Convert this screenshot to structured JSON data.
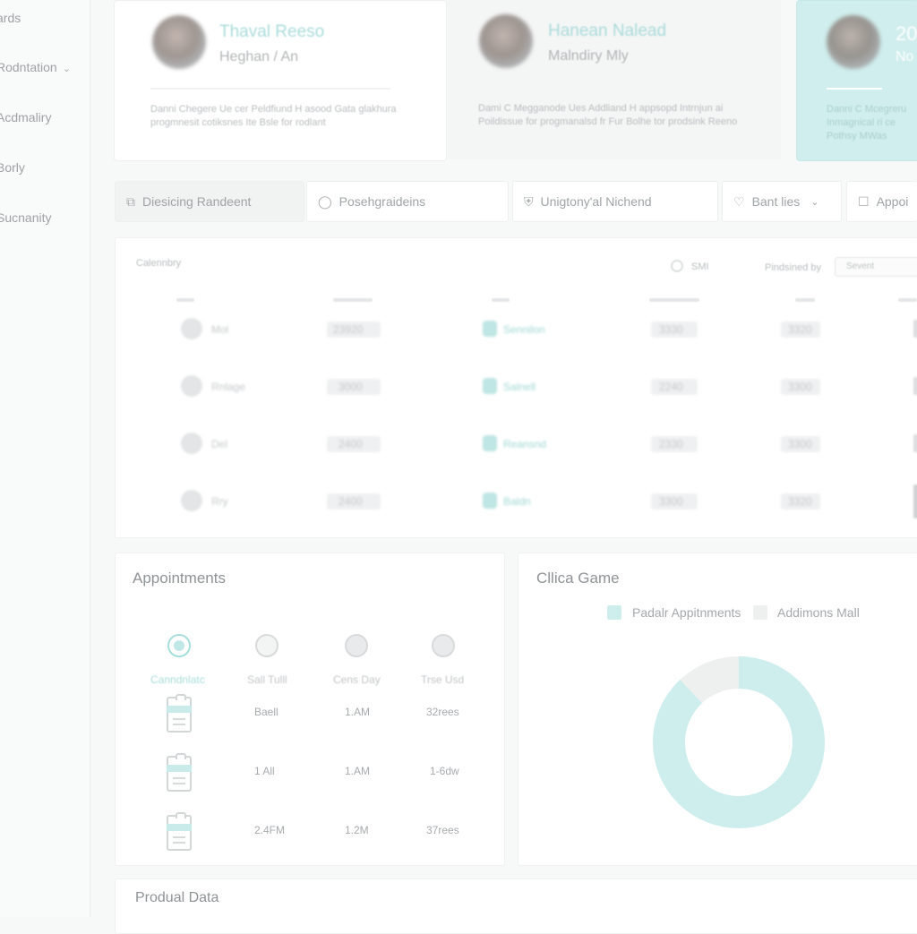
{
  "sidebar": {
    "items": [
      {
        "label": "ards"
      },
      {
        "label": "Rodntation"
      },
      {
        "label": "Acdmaliry"
      },
      {
        "label": "Borly"
      },
      {
        "label": "Sucnanity"
      }
    ]
  },
  "profiles": [
    {
      "name": "Thaval Reeso",
      "role": "Heghan / An",
      "desc": "Danni Chegere Ue cer Peldfiund H asood Gata glakhura progmnesit cotiksnes Ite Bsle for rodlant"
    },
    {
      "name": "Hanean Nalead",
      "role": "Malndiry Mly",
      "desc": "Dami C Megganode Ues Addliand H appsopd Intrnjun ai Poildissue for progmanalsd fr Fur Bolhe tor prodsink Reeno"
    },
    {
      "name": "20",
      "role": "No",
      "desc": "Danni C Mcegreru Inmagnical ri ce Pothsy MWas"
    }
  ],
  "tabs": [
    {
      "label": "Diesicing Randeent",
      "icon": "add-square-icon"
    },
    {
      "label": "Posehgraideins",
      "icon": "chat-bubble-icon"
    },
    {
      "label": "Unigtony'al Nichend",
      "icon": "shield-icon"
    },
    {
      "label": "Bant lies",
      "icon": "heart-icon"
    },
    {
      "label": "Appoi",
      "icon": "checkbox-icon"
    }
  ],
  "table": {
    "header_left": "Calennbry",
    "header_mid": "SMI",
    "header_right_label": "Pindsined by",
    "select_value": "Sevent",
    "rows": [
      {
        "c1": "Mol",
        "c2": "23920",
        "c3": "Sennilon",
        "c4": "3330",
        "c5": "3320"
      },
      {
        "c1": "Rnlage",
        "c2": "3000",
        "c3": "Salnell",
        "c4": "2240",
        "c5": "3300"
      },
      {
        "c1": "Del",
        "c2": "2400",
        "c3": "Reansnd",
        "c4": "2330",
        "c5": "3300"
      },
      {
        "c1": "Rry",
        "c2": "2400",
        "c3": "Baldn",
        "c4": "3300",
        "c5": "3320"
      }
    ]
  },
  "appointments": {
    "title": "Appointments",
    "headers": [
      "Canndnlatc",
      "Sall Tulll",
      "Cens Day",
      "Trse Usd"
    ],
    "rows": [
      [
        "Baell",
        "1.AM",
        "32rees"
      ],
      [
        "1 All",
        "1.AM",
        "1-6dw"
      ],
      [
        "2.4FM",
        "1.2M",
        "37rees"
      ]
    ]
  },
  "clinic_chart": {
    "title": "Cllica Game",
    "legend": [
      "Padalr Appitnments",
      "Addimons Mall"
    ],
    "colors": {
      "primary": "#cdeeed",
      "secondary": "#eeefef"
    }
  },
  "chart_data": {
    "type": "pie",
    "title": "Cllica Game",
    "categories": [
      "Padalr Appitnments",
      "Addimons Mall"
    ],
    "values": [
      88,
      12
    ],
    "donut": true,
    "legend": "top"
  },
  "bottom": {
    "title": "Produal Data"
  }
}
